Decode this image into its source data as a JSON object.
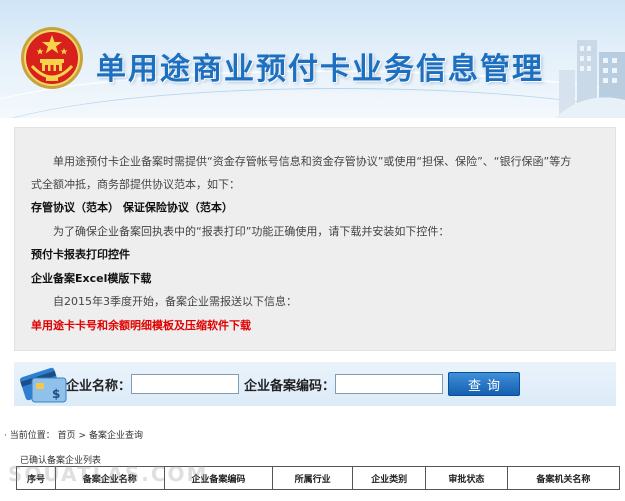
{
  "header": {
    "title": "单用途商业预付卡业务信息管理"
  },
  "notice": {
    "line1": "单用途预付卡企业备案时需提供“资金存管帐号信息和资金存管协议”或使用“担保、保险”、“银行保函”等方",
    "line2": "式全额冲抵，商务部提供协议范本，如下：",
    "link_agreements": "存管协议（范本）  保证保险协议（范本）",
    "line3": "为了确保企业备案回执表中的“报表打印”功能正确使用，请下载并安装如下控件：",
    "link_print_control": "预付卡报表打印控件",
    "link_excel_template": "企业备案Excel模版下载",
    "line4": "自2015年3季度开始，备案企业需报送以下信息：",
    "link_card_template": "单用途卡卡号和余额明细模板及压缩软件下载"
  },
  "search": {
    "company_name_label": "企业名称：",
    "company_name_value": "",
    "record_no_label": "企业备案编码：",
    "record_no_value": "",
    "button_label": "查询"
  },
  "breadcrumb": {
    "prefix": "当前位置：",
    "home": "首页",
    "separator": ">",
    "current": "备案企业查询"
  },
  "results": {
    "title": "已确认备案企业列表",
    "columns": [
      "序号",
      "备案企业名称",
      "企业备案编码",
      "所属行业",
      "企业类别",
      "审批状态",
      "备案机关名称"
    ]
  },
  "watermark": "SOUATLAS.COM",
  "colors": {
    "title_blue": "#1d6fbf",
    "button_blue": "#1560b0",
    "link_red": "#e00000",
    "panel_grey": "#eeeeee"
  }
}
